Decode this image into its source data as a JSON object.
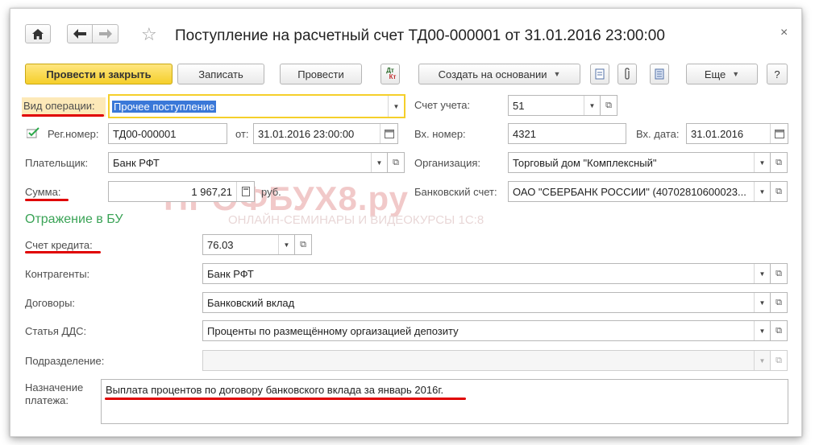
{
  "header": {
    "title": "Поступление на расчетный счет ТД00-000001 от 31.01.2016 23:00:00",
    "close_glyph": "×"
  },
  "toolbar": {
    "post_close": "Провести и закрыть",
    "save": "Записать",
    "post": "Провести",
    "dtkt_top": "Дт",
    "dtkt_bottom": "Кт",
    "create_based": "Создать на основании",
    "more": "Еще",
    "help": "?"
  },
  "form": {
    "operation_type": {
      "label": "Вид операции:",
      "value": "Прочее поступление"
    },
    "account": {
      "label": "Счет учета:",
      "value": "51"
    },
    "reg_number": {
      "label": "Рег.номер:",
      "value": "ТД00-000001"
    },
    "date": {
      "label": "от:",
      "value": "31.01.2016 23:00:00"
    },
    "in_number": {
      "label": "Вх. номер:",
      "value": "4321"
    },
    "in_date": {
      "label": "Вх. дата:",
      "value": "31.01.2016"
    },
    "payer": {
      "label": "Плательщик:",
      "value": "Банк РФТ"
    },
    "organization": {
      "label": "Организация:",
      "value": "Торговый дом \"Комплексный\""
    },
    "amount": {
      "label": "Сумма:",
      "value": "1 967,21",
      "unit": "руб."
    },
    "bank_account": {
      "label": "Банковский счет:",
      "value": "ОАО \"СБЕРБАНК РОССИИ\" (40702810600023..."
    }
  },
  "bu_section": {
    "title": "Отражение в БУ",
    "credit_account": {
      "label": "Счет кредита:",
      "value": "76.03"
    },
    "counterparties": {
      "label": "Контрагенты:",
      "value": "Банк РФТ"
    },
    "contracts": {
      "label": "Договоры:",
      "value": "Банковский вклад"
    },
    "dds_item": {
      "label": "Статья ДДС:",
      "value": "Проценты по размещённому оргаизацией депозиту"
    },
    "department": {
      "label": "Подразделение:",
      "value": ""
    },
    "purpose": {
      "label_line1": "Назначение",
      "label_line2": "платежа:",
      "value": "Выплата процентов по договору банковского вклада за январь 2016г."
    }
  },
  "watermark": {
    "brand": "ПРОФБУХ8.ру",
    "tagline": "ОНЛАЙН-СЕМИНАРЫ И ВИДЕОКУРСЫ 1С:8"
  },
  "colors": {
    "accent_green": "#3aa356",
    "primary_button": "#f5cf2a",
    "underline_red": "#e00000",
    "selection_blue": "#3a78d8"
  }
}
